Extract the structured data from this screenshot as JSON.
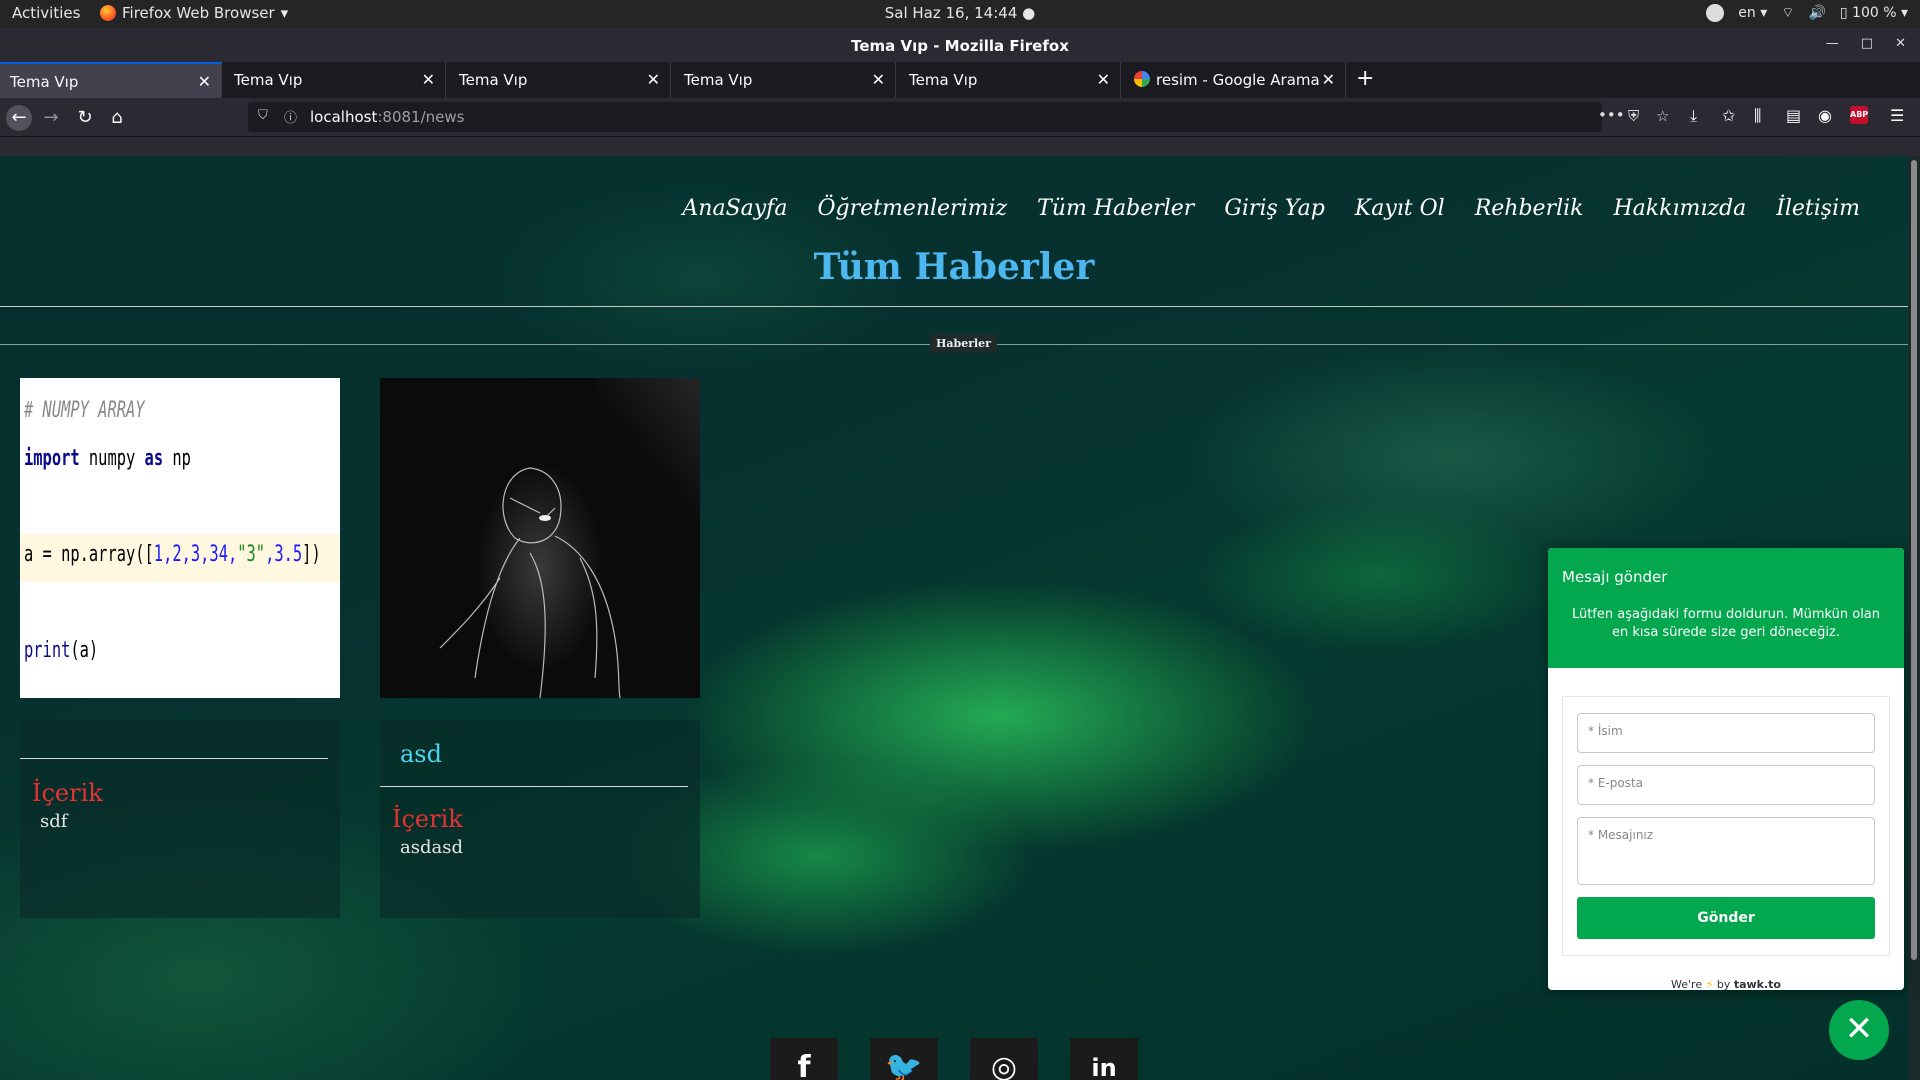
{
  "system": {
    "activities": "Activities",
    "app_menu": "Firefox Web Browser",
    "clock": "Sal Haz 16, 14:44",
    "lang": "en",
    "battery": "100 %"
  },
  "window": {
    "title": "Tema Vıp - Mozilla Firefox"
  },
  "tabs": [
    {
      "label": "Tema Vıp"
    },
    {
      "label": "Tema Vıp"
    },
    {
      "label": "Tema Vıp"
    },
    {
      "label": "Tema Vıp"
    },
    {
      "label": "Tema Vıp"
    },
    {
      "label": "resim - Google Arama"
    }
  ],
  "urlbar": {
    "host": "localhost",
    "rest": ":8081/news"
  },
  "site": {
    "nav": [
      "AnaSayfa",
      "Öğretmenlerimiz",
      "Tüm Haberler",
      "Giriş Yap",
      "Kayıt Ol",
      "Rehberlik",
      "Hakkımızda",
      "İletişim"
    ],
    "page_title": "Tüm Haberler",
    "divider_badge": "Haberler",
    "cards": [
      {
        "title": "",
        "label": "İçerik",
        "text": "sdf"
      },
      {
        "title": "asd",
        "label": "İçerik",
        "text": "asdasd"
      }
    ],
    "code": {
      "comment": "#           NUMPY ARRAY",
      "l2a": "import",
      "l2b": " numpy ",
      "l2c": "as",
      "l2d": " np",
      "l3a": "a = np.array([",
      "l3b": "1,2,3,34,",
      "l3c": "\"3\"",
      "l3d": ",3.5",
      "l3e": "])",
      "l4a": "print",
      "l4b": "(a)"
    },
    "social": [
      {
        "icon": "facebook-icon",
        "glyph": "f"
      },
      {
        "icon": "twitter-icon",
        "glyph": "🐦"
      },
      {
        "icon": "instagram-icon",
        "glyph": "◎"
      },
      {
        "icon": "linkedin-icon",
        "glyph": "in"
      }
    ]
  },
  "tawk": {
    "title": "Mesajı gönder",
    "subtitle": "Lütfen aşağıdaki formu doldurun. Mümkün olan en kısa sürede size geri döneceğiz.",
    "name_placeholder": "* İsim",
    "email_placeholder": "* E-posta",
    "message_placeholder": "* Mesajınız",
    "send": "Gönder",
    "brand_pre": "We're",
    "brand_by": "by",
    "brand_name": "tawk.to",
    "accent": "#03a84e"
  }
}
